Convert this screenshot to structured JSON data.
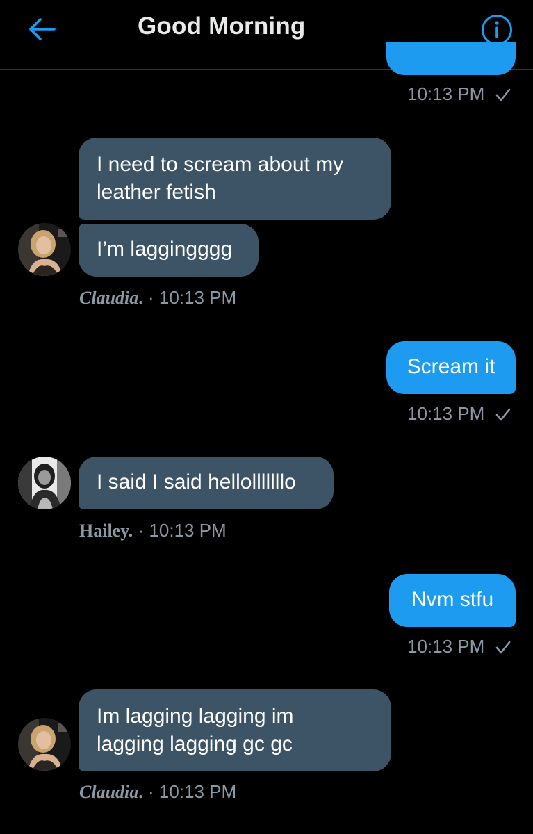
{
  "header": {
    "title": "Good Morning",
    "back_icon": "arrow-left-icon",
    "info_icon": "info-circle-icon",
    "accent_color": "#1d9bf0"
  },
  "messages": [
    {
      "id": "m0",
      "direction": "sent",
      "text": "",
      "time": "10:13 PM",
      "status_icon": "check-icon"
    },
    {
      "id": "m1",
      "direction": "received",
      "lines": [
        "I need to scream about my",
        "leather fetish"
      ]
    },
    {
      "id": "m2",
      "direction": "received",
      "text": "I’m laggingggg",
      "sender": "Claudia",
      "sender_suffix": ".",
      "separator": "·",
      "time": "10:13 PM"
    },
    {
      "id": "m3",
      "direction": "sent",
      "text": "Scream it",
      "time": "10:13 PM",
      "status_icon": "check-icon"
    },
    {
      "id": "m4",
      "direction": "received",
      "text": "I said I said hellolllllllo",
      "sender": "Hailey",
      "sender_suffix": ".",
      "separator": "·",
      "time": "10:13 PM"
    },
    {
      "id": "m5",
      "direction": "sent",
      "text": "Nvm stfu",
      "time": "10:13 PM",
      "status_icon": "check-icon"
    },
    {
      "id": "m6",
      "direction": "received",
      "lines": [
        "Im lagging lagging im",
        "lagging lagging gc gc"
      ],
      "sender": "Claudia",
      "sender_suffix": ".",
      "separator": "·",
      "time": "10:13 PM"
    }
  ],
  "colors": {
    "received_bubble": "#3d5466",
    "sent_bubble": "#1d9bf0",
    "meta_text": "#8b98a5",
    "background": "#000000"
  }
}
